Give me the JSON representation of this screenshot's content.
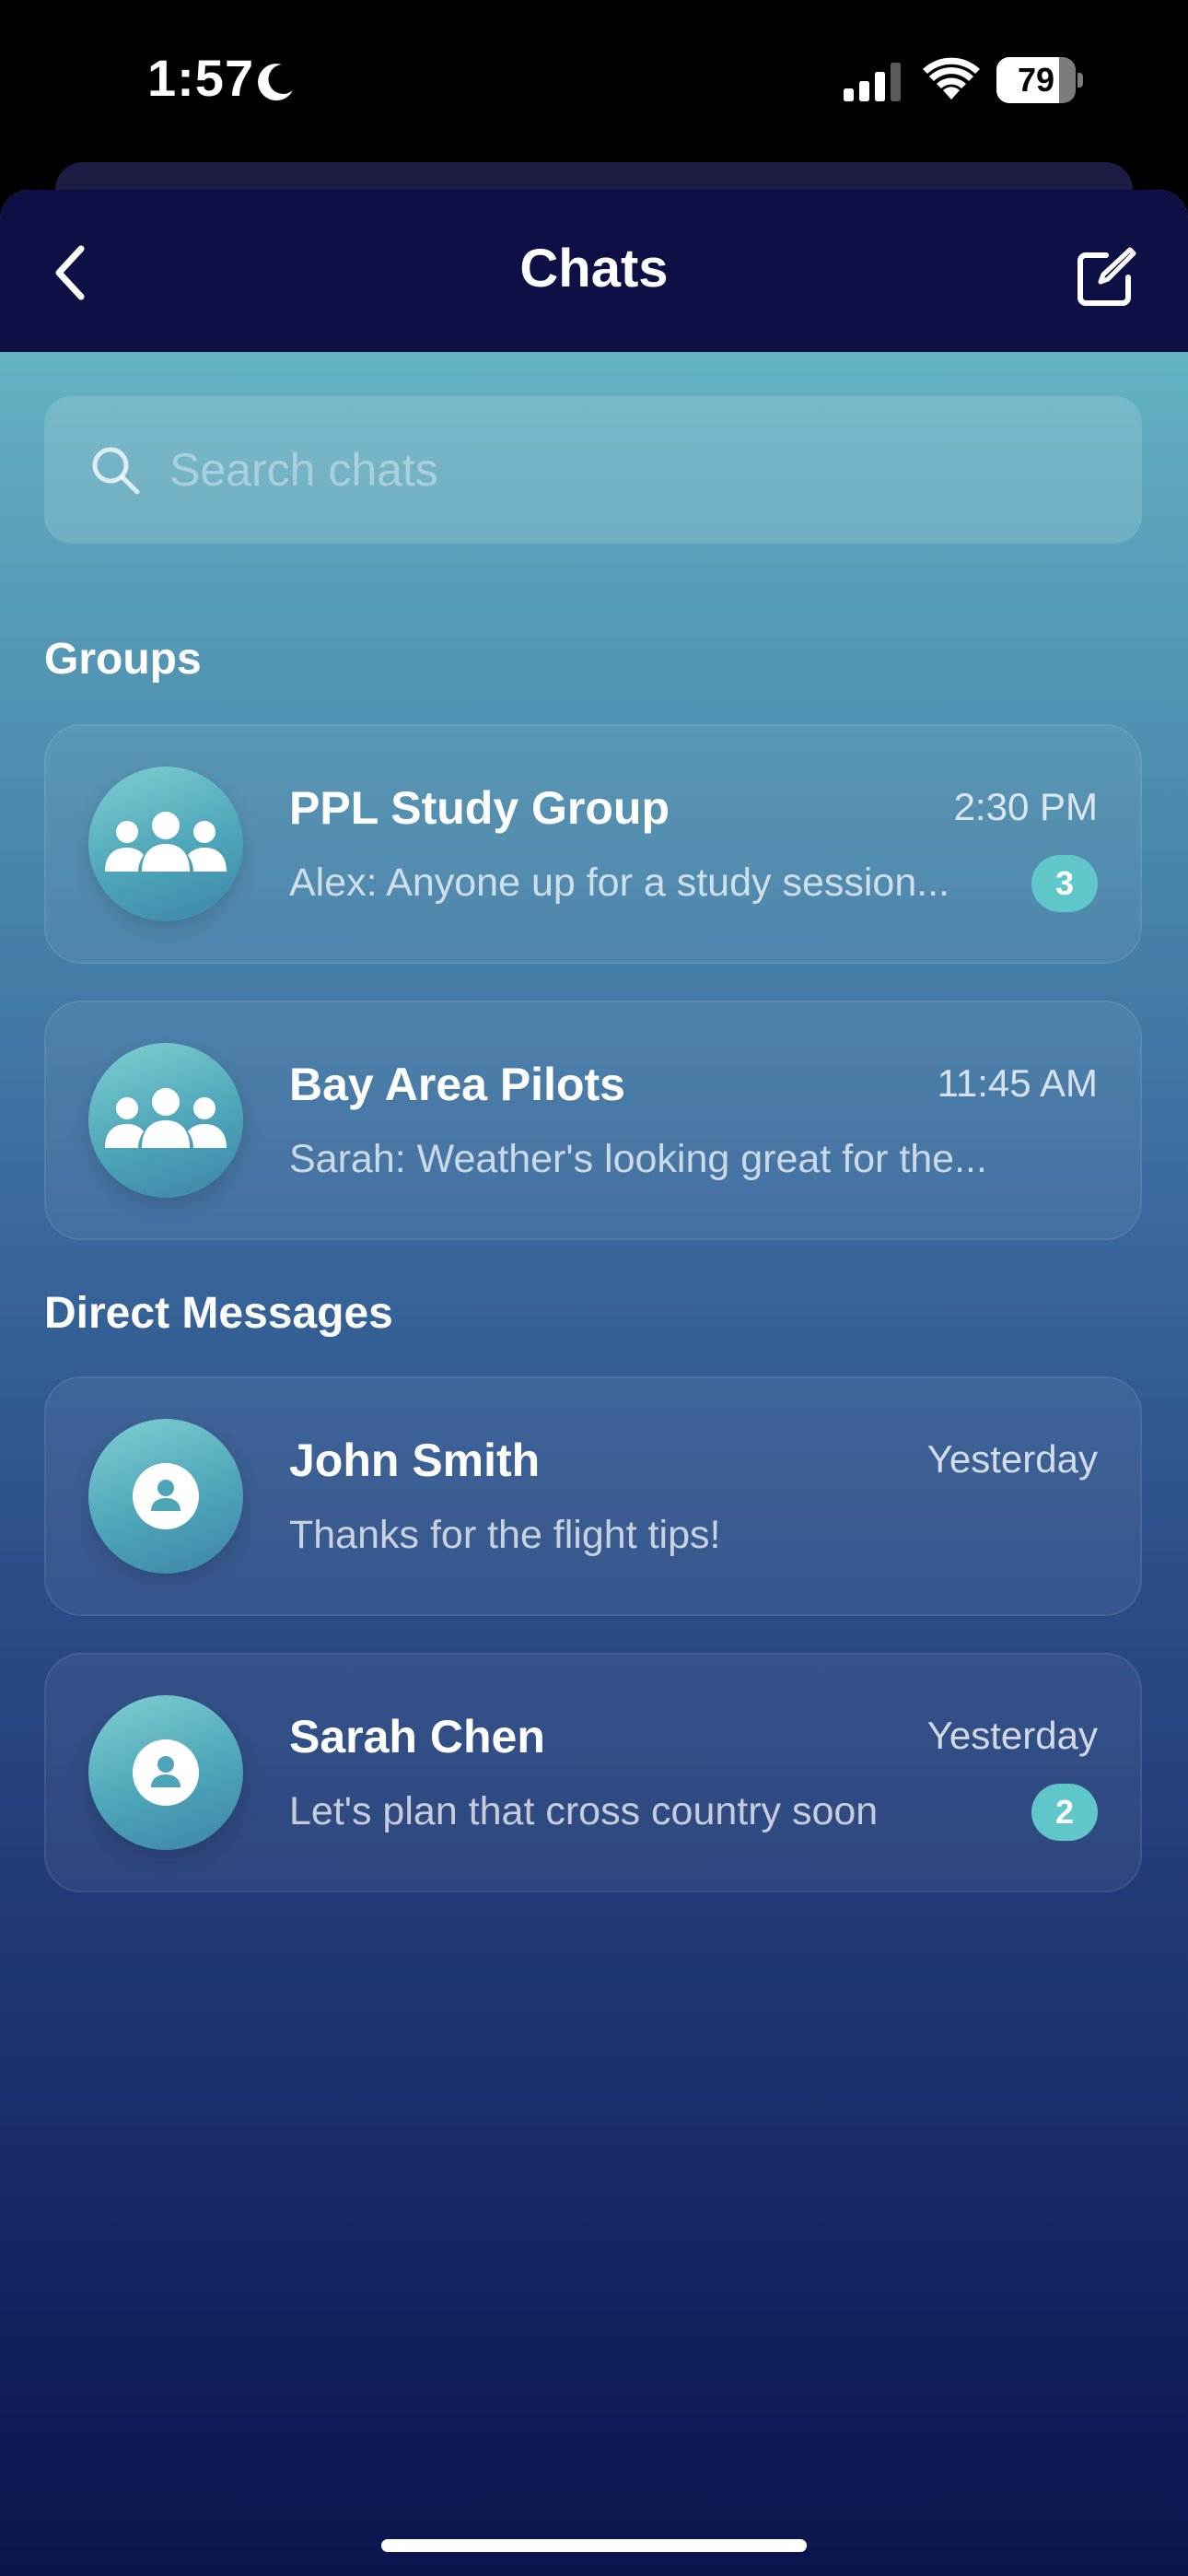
{
  "status_bar": {
    "time": "1:57",
    "battery": "79",
    "battery_level": 0.79,
    "icons": [
      "moon-icon",
      "signal-icon",
      "wifi-icon",
      "battery-icon"
    ]
  },
  "header": {
    "title": "Chats",
    "back_icon": "chevron-left-icon",
    "compose_icon": "compose-icon"
  },
  "search": {
    "placeholder": "Search chats",
    "value": ""
  },
  "sections": {
    "groups_title": "Groups",
    "direct_title": "Direct Messages"
  },
  "groups": [
    {
      "name": "PPL Study Group",
      "time": "2:30 PM",
      "preview": "Alex: Anyone up for a study session...",
      "unread": "3",
      "avatar_icon": "group-icon"
    },
    {
      "name": "Bay Area Pilots",
      "time": "11:45 AM",
      "preview": "Sarah: Weather's looking great for the...",
      "unread": "",
      "avatar_icon": "group-icon"
    }
  ],
  "direct_messages": [
    {
      "name": "John Smith",
      "time": "Yesterday",
      "preview": "Thanks for the flight tips!",
      "unread": "",
      "avatar_icon": "person-icon"
    },
    {
      "name": "Sarah Chen",
      "time": "Yesterday",
      "preview": "Let's plan that cross country soon",
      "unread": "2",
      "avatar_icon": "person-icon"
    }
  ],
  "colors": {
    "header_bg": "#0e0f45",
    "accent": "#5fc6c9",
    "gradient_top": "#6ac6cb",
    "gradient_bottom": "#0b154d"
  }
}
